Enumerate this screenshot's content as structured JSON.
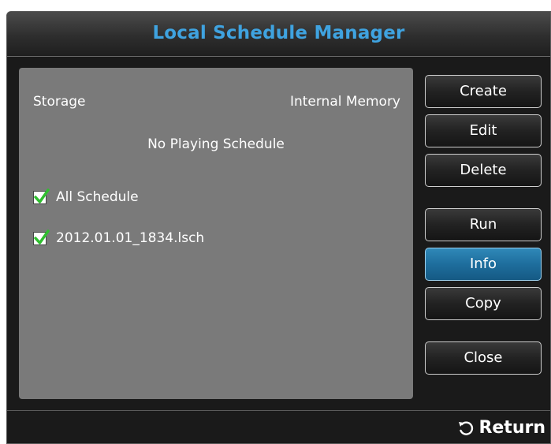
{
  "dialog": {
    "title": "Local Schedule Manager"
  },
  "panel": {
    "storage_label": "Storage",
    "storage_value": "Internal Memory",
    "status_text": "No Playing Schedule",
    "items": [
      {
        "label": "All Schedule",
        "checked": true
      },
      {
        "label": "2012.01.01_1834.lsch",
        "checked": true
      }
    ]
  },
  "buttons": {
    "create": "Create",
    "edit": "Edit",
    "delete": "Delete",
    "run": "Run",
    "info": "Info",
    "copy": "Copy",
    "close": "Close",
    "active": "Info"
  },
  "footer": {
    "return_label": "Return",
    "return_icon": "return-arrow-icon"
  },
  "colors": {
    "title": "#3fa3e0",
    "panel": "#7a7a7a",
    "active_button": "#1e6e9d",
    "checkmark": "#2fbf2f"
  }
}
